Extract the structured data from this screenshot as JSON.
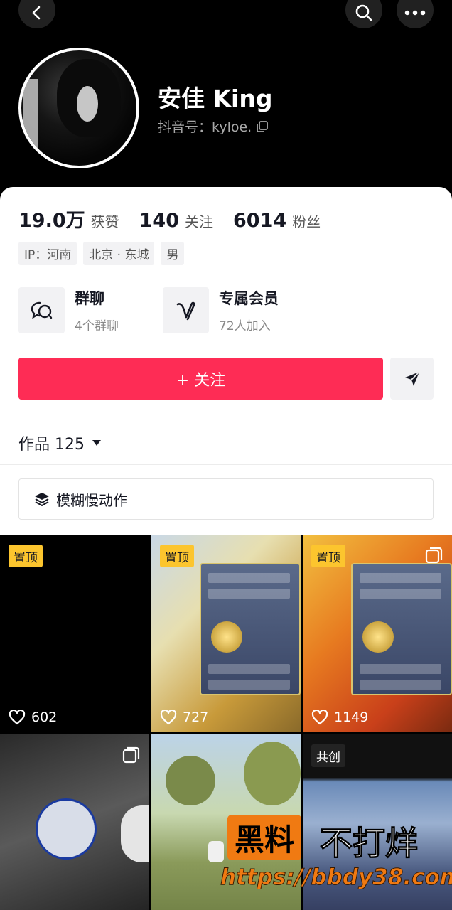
{
  "profile": {
    "name": "安佳 King",
    "douyin_id": "抖音号：kyloe."
  },
  "stats": [
    {
      "value": "19.0万",
      "label": "获赞"
    },
    {
      "value": "140",
      "label": "关注"
    },
    {
      "value": "6014",
      "label": "粉丝"
    }
  ],
  "tags": [
    "IP：河南",
    "北京 · 东城",
    "男"
  ],
  "entries": {
    "group": {
      "title": "群聊",
      "sub": "4个群聊"
    },
    "member": {
      "title": "专属会员",
      "sub": "72人加入"
    }
  },
  "follow_label": "+ 关注",
  "works_label": "作品 125",
  "blur_label": "模糊慢动作",
  "videos": [
    {
      "badge": "置顶",
      "likes": "602"
    },
    {
      "badge": "置顶",
      "likes": "727"
    },
    {
      "badge": "置顶",
      "likes": "1149"
    },
    {
      "badge": "",
      "likes": ""
    },
    {
      "badge": "",
      "likes": ""
    },
    {
      "badge": "共创",
      "likes": ""
    }
  ],
  "watermark": {
    "brand_black": "黑料",
    "brand_rest": "不打烊",
    "url": "https://bbdy38.com"
  },
  "colors": {
    "accent": "#fe2c55",
    "pin_badge": "#fcc52e",
    "watermark": "#f07a12"
  }
}
